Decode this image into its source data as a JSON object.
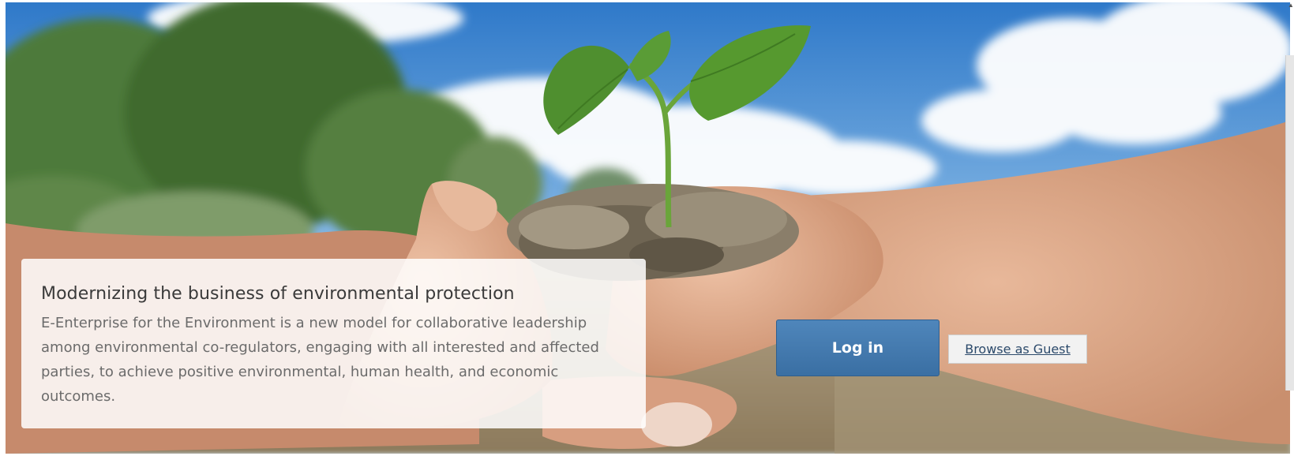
{
  "hero": {
    "image_description_icon": "seedling-in-hands-image",
    "headline": "Modernizing the business of environmental protection",
    "body": "E-Enterprise for the Environment is a new model for collaborative leadership among environmental co-regulators, engaging with all interested and affected parties, to achieve positive environmental, human health, and economic outcomes."
  },
  "actions": {
    "login_label": "Log in",
    "guest_label": "Browse as Guest"
  },
  "colors": {
    "primary_button": "#3f76aa",
    "card_background": "#ffffff"
  }
}
